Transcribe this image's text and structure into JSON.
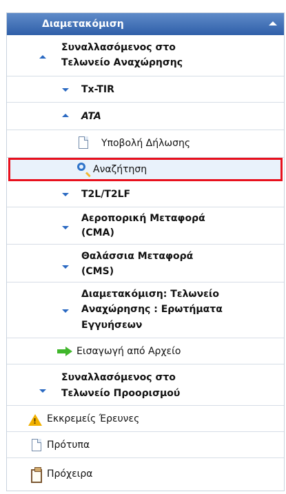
{
  "header": {
    "title": "Διαμετακόμιση"
  },
  "items": {
    "departure_title_1": "Συναλλασόμενος στο",
    "departure_title_2": "Τελωνείο Αναχώρησης",
    "tx_tir": "Tx-TIR",
    "ata": "ATA",
    "submit_declaration": "Υποβολή Δήλωσης",
    "search": "Αναζήτηση",
    "t2l": "T2L/T2LF",
    "air_1": "Αεροπορική Μεταφορά",
    "air_2": "(CMA)",
    "sea_1": "Θαλάσσια Μεταφορά",
    "sea_2": "(CMS)",
    "transit_1": "Διαμετακόμιση: Τελωνείο",
    "transit_2": "Αναχώρησης : Ερωτήματα",
    "transit_3": "Εγγυήσεων",
    "import_file": "Εισαγωγή από Αρχείο",
    "destination_1": "Συναλλασόμενος στο",
    "destination_2": "Τελωνείο Προορισμού",
    "pending": "Εκκρεμείς Έρευνες",
    "templates": "Πρότυπα",
    "drafts": "Πρόχειρα"
  }
}
